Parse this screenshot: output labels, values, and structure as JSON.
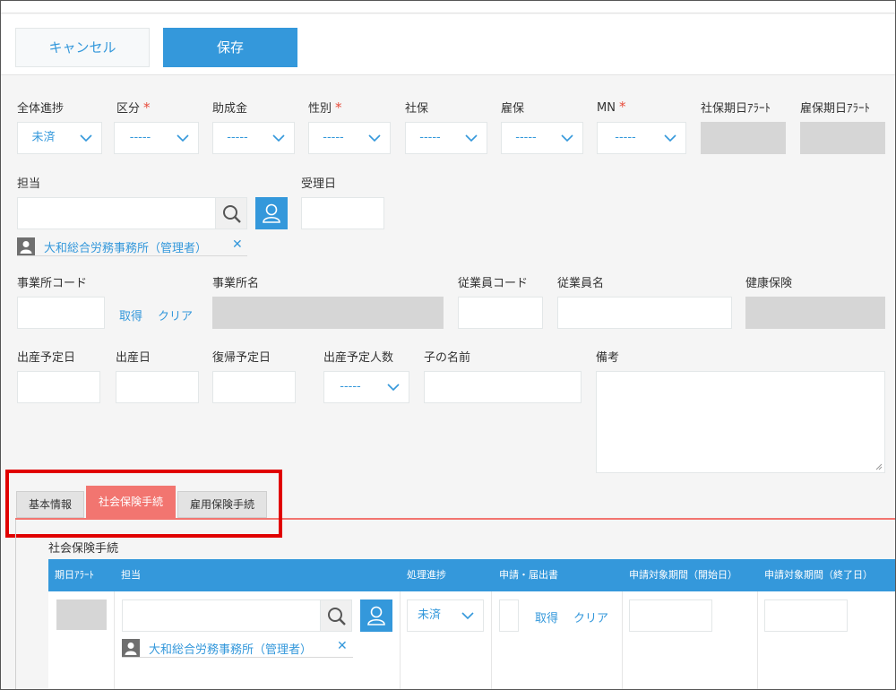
{
  "toolbar": {
    "cancel_label": "キャンセル",
    "save_label": "保存"
  },
  "row1": {
    "overall_progress": {
      "label": "全体進捗",
      "value": "未済"
    },
    "category": {
      "label": "区分",
      "value": "-----"
    },
    "subsidy": {
      "label": "助成金",
      "value": "-----"
    },
    "gender": {
      "label": "性別",
      "value": "-----"
    },
    "social_insurance": {
      "label": "社保",
      "value": "-----"
    },
    "employment_insurance": {
      "label": "雇保",
      "value": "-----"
    },
    "mn": {
      "label": "MN",
      "value": "-----"
    },
    "social_due_alert": {
      "label": "社保期日ｱﾗｰﾄ"
    },
    "employment_due_alert": {
      "label": "雇保期日ｱﾗｰﾄ"
    },
    "required_mark": "*"
  },
  "row2": {
    "assignee_label": "担当",
    "assignee_chip": "大和総合労務事務所（管理者）",
    "received_date_label": "受理日",
    "remove_glyph": "✕"
  },
  "row3": {
    "office_code_label": "事業所コード",
    "get_link": "取得",
    "clear_link": "クリア",
    "office_name_label": "事業所名",
    "employee_code_label": "従業員コード",
    "employee_name_label": "従業員名",
    "health_insurance_label": "健康保険"
  },
  "row4": {
    "due_date_label": "出産予定日",
    "birth_date_label": "出産日",
    "return_date_label": "復帰予定日",
    "expected_children_label": "出産予定人数",
    "expected_children_value": "-----",
    "child_name_label": "子の名前",
    "notes_label": "備考"
  },
  "tabs": [
    {
      "label": "基本情報"
    },
    {
      "label": "社会保険手続"
    },
    {
      "label": "雇用保険手続"
    }
  ],
  "section": {
    "title": "社会保険手続",
    "columns": [
      "期日ｱﾗｰﾄ",
      "担当",
      "処理進捗",
      "申請・届出書",
      "申請対象期間（開始日）",
      "申請対象期間（終了日）"
    ],
    "row": {
      "assignee_chip": "大和総合労務事務所（管理者）",
      "progress_value": "未済",
      "get_link": "取得",
      "clear_link": "クリア"
    }
  },
  "colors": {
    "accent": "#3498db",
    "active_tab": "#f27570",
    "highlight": "#e00000",
    "required": "#e74c3c"
  }
}
